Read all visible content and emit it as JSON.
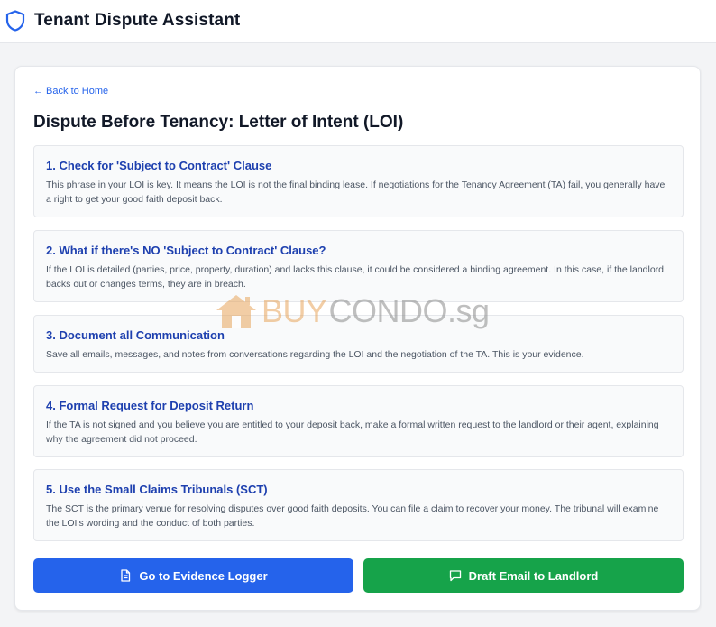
{
  "header": {
    "app_title": "Tenant Dispute Assistant",
    "logo_icon": "shield-icon"
  },
  "main": {
    "back_link": "← Back to Home",
    "page_title": "Dispute Before Tenancy: Letter of Intent (LOI)",
    "steps": [
      {
        "title": "1. Check for 'Subject to Contract' Clause",
        "description": "This phrase in your LOI is key. It means the LOI is not the final binding lease. If negotiations for the Tenancy Agreement (TA) fail, you generally have a right to get your good faith deposit back."
      },
      {
        "title": "2. What if there's NO 'Subject to Contract' Clause?",
        "description": "If the LOI is detailed (parties, price, property, duration) and lacks this clause, it could be considered a binding agreement. In this case, if the landlord backs out or changes terms, they are in breach."
      },
      {
        "title": "3. Document all Communication",
        "description": "Save all emails, messages, and notes from conversations regarding the LOI and the negotiation of the TA. This is your evidence."
      },
      {
        "title": "4. Formal Request for Deposit Return",
        "description": "If the TA is not signed and you believe you are entitled to your deposit back, make a formal written request to the landlord or their agent, explaining why the agreement did not proceed."
      },
      {
        "title": "5. Use the Small Claims Tribunals (SCT)",
        "description": "The SCT is the primary venue for resolving disputes over good faith deposits. You can file a claim to recover your money. The tribunal will examine the LOI's wording and the conduct of both parties."
      }
    ],
    "buttons": {
      "evidence_logger": "Go to Evidence Logger",
      "evidence_logger_icon": "document-icon",
      "draft_email": "Draft Email to Landlord",
      "draft_email_icon": "chat-bubble-icon"
    }
  },
  "watermark": {
    "part1": "BUY",
    "part2": "CONDO.sg"
  },
  "colors": {
    "accent_blue": "#2563eb",
    "heading_blue": "#1e40af",
    "success_green": "#16a34a"
  }
}
